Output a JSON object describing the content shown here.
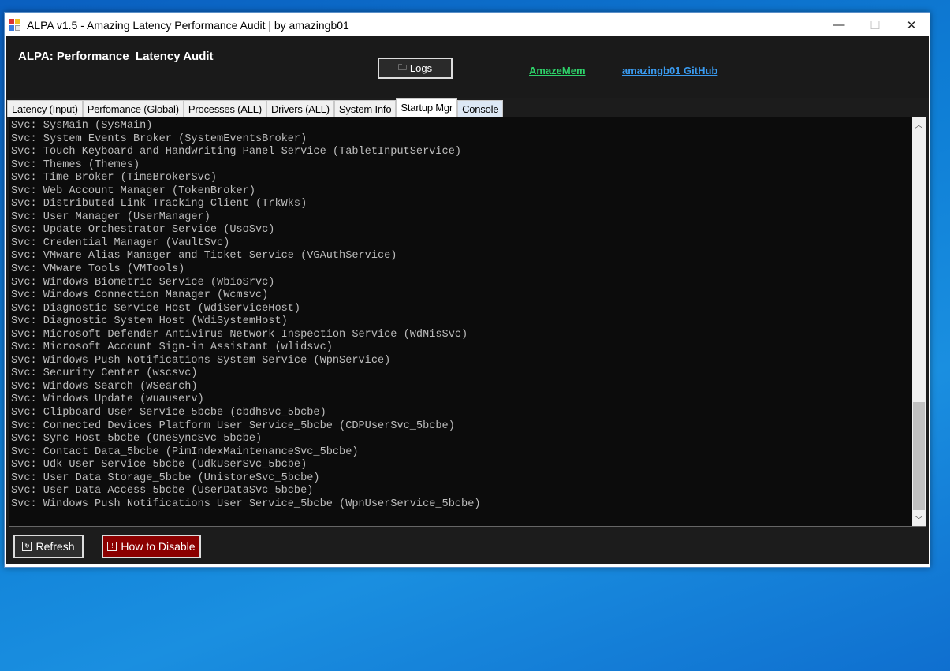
{
  "window": {
    "title": "ALPA v1.5 - Amazing Latency Performance Audit | by amazingb01",
    "minimize": "—",
    "maximize": "☐",
    "close": "✕"
  },
  "header": {
    "title": "ALPA: Performance  Latency Audit",
    "logs_label": "Logs",
    "links": [
      {
        "label": "AmazeMem",
        "color": "#2ed36a"
      },
      {
        "label": "amazingb01 GitHub",
        "color": "#3a9bf0"
      }
    ]
  },
  "tabs": [
    {
      "label": "Latency (Input)"
    },
    {
      "label": "Perfomance (Global)"
    },
    {
      "label": "Processes (ALL)"
    },
    {
      "label": "Drivers (ALL)"
    },
    {
      "label": "System Info"
    },
    {
      "label": "Startup Mgr",
      "active": true
    },
    {
      "label": "Console"
    }
  ],
  "output_lines": [
    "Svc: SysMain (SysMain)",
    "Svc: System Events Broker (SystemEventsBroker)",
    "Svc: Touch Keyboard and Handwriting Panel Service (TabletInputService)",
    "Svc: Themes (Themes)",
    "Svc: Time Broker (TimeBrokerSvc)",
    "Svc: Web Account Manager (TokenBroker)",
    "Svc: Distributed Link Tracking Client (TrkWks)",
    "Svc: User Manager (UserManager)",
    "Svc: Update Orchestrator Service (UsoSvc)",
    "Svc: Credential Manager (VaultSvc)",
    "Svc: VMware Alias Manager and Ticket Service (VGAuthService)",
    "Svc: VMware Tools (VMTools)",
    "Svc: Windows Biometric Service (WbioSrvc)",
    "Svc: Windows Connection Manager (Wcmsvc)",
    "Svc: Diagnostic Service Host (WdiServiceHost)",
    "Svc: Diagnostic System Host (WdiSystemHost)",
    "Svc: Microsoft Defender Antivirus Network Inspection Service (WdNisSvc)",
    "Svc: Microsoft Account Sign-in Assistant (wlidsvc)",
    "Svc: Windows Push Notifications System Service (WpnService)",
    "Svc: Security Center (wscsvc)",
    "Svc: Windows Search (WSearch)",
    "Svc: Windows Update (wuauserv)",
    "Svc: Clipboard User Service_5bcbe (cbdhsvc_5bcbe)",
    "Svc: Connected Devices Platform User Service_5bcbe (CDPUserSvc_5bcbe)",
    "Svc: Sync Host_5bcbe (OneSyncSvc_5bcbe)",
    "Svc: Contact Data_5bcbe (PimIndexMaintenanceSvc_5bcbe)",
    "Svc: Udk User Service_5bcbe (UdkUserSvc_5bcbe)",
    "Svc: User Data Storage_5bcbe (UnistoreSvc_5bcbe)",
    "Svc: User Data Access_5bcbe (UserDataSvc_5bcbe)",
    "Svc: Windows Push Notifications User Service_5bcbe (WpnUserService_5bcbe)"
  ],
  "buttons": {
    "refresh": "Refresh",
    "how_to_disable": "How to Disable",
    "how_to_disable_color": "#8b0000"
  }
}
